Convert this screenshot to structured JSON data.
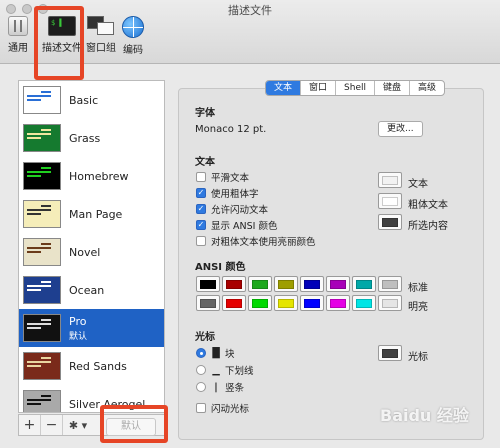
{
  "window": {
    "title": "描述文件"
  },
  "toolbar": {
    "general": "通用",
    "profiles": "描述文件",
    "window_groups": "窗口组",
    "encodings": "编码",
    "profiles_icon_text": "$ ▌"
  },
  "profiles": [
    {
      "name": "Basic",
      "bg": "#ffffff",
      "fg": "#2a6fd6"
    },
    {
      "name": "Grass",
      "bg": "#157a2f",
      "fg": "#f0e8a0"
    },
    {
      "name": "Homebrew",
      "bg": "#000000",
      "fg": "#20d020"
    },
    {
      "name": "Man Page",
      "bg": "#f5edb9",
      "fg": "#333333"
    },
    {
      "name": "Novel",
      "bg": "#e9e3c9",
      "fg": "#6b3b1a"
    },
    {
      "name": "Ocean",
      "bg": "#1e3f8f",
      "fg": "#ffffff"
    },
    {
      "name": "Pro",
      "sub": "默认",
      "bg": "#111111",
      "fg": "#dddddd"
    },
    {
      "name": "Red Sands",
      "bg": "#7a2a1a",
      "fg": "#e9d6a0"
    },
    {
      "name": "Silver Aerogel",
      "bg": "#a9a9a9",
      "fg": "#111111"
    }
  ],
  "list_footer": {
    "add": "+",
    "remove": "−",
    "gear": "✱ ▾",
    "default": "默认"
  },
  "tabs": [
    "文本",
    "窗口",
    "Shell",
    "键盘",
    "高级"
  ],
  "font": {
    "title": "字体",
    "value": "Monaco 12 pt.",
    "change": "更改..."
  },
  "text": {
    "title": "文本",
    "options": [
      {
        "label": "平滑文本",
        "checked": false
      },
      {
        "label": "使用粗体字",
        "checked": true
      },
      {
        "label": "允许闪动文本",
        "checked": true
      },
      {
        "label": "显示 ANSI 颜色",
        "checked": true
      },
      {
        "label": "对粗体文本使用亮丽颜色",
        "checked": false
      }
    ],
    "colors": [
      {
        "label": "文本",
        "color": "#f2f2f2"
      },
      {
        "label": "粗体文本",
        "color": "#ffffff"
      },
      {
        "label": "所选内容",
        "color": "#404040"
      }
    ]
  },
  "ansi": {
    "title": "ANSI 颜色",
    "normal_label": "标准",
    "bright_label": "明亮",
    "normal": [
      "#000000",
      "#a80000",
      "#1ba81b",
      "#9e9e00",
      "#0000b8",
      "#a800b8",
      "#00a8a8",
      "#bfbfbf"
    ],
    "bright": [
      "#666666",
      "#e50000",
      "#00d900",
      "#e5e500",
      "#0000ff",
      "#e500e5",
      "#00e5e5",
      "#e5e5e5"
    ]
  },
  "cursor": {
    "title": "光标",
    "options": [
      {
        "glyph": "█",
        "label": "块",
        "selected": true
      },
      {
        "glyph": "▁",
        "label": "下划线",
        "selected": false
      },
      {
        "glyph": "|",
        "label": "竖条",
        "selected": false
      }
    ],
    "blink": "闪动光标",
    "color_label": "光标",
    "color": "#404040"
  },
  "watermark": "Baidu 经验"
}
